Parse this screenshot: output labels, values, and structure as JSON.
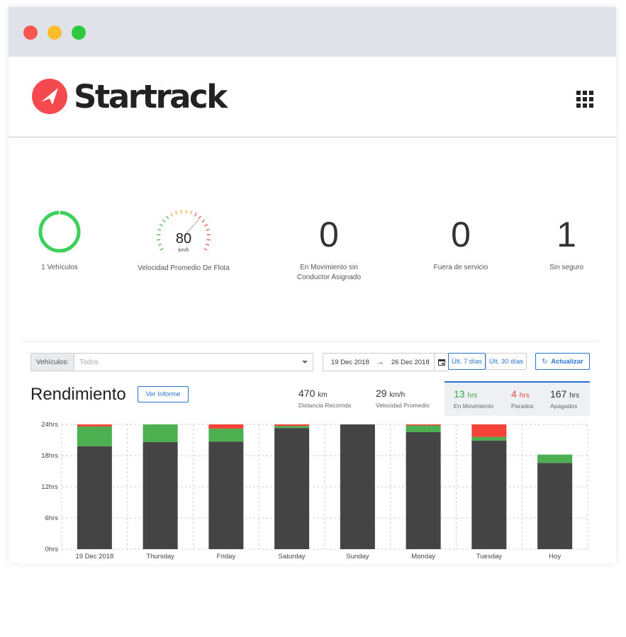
{
  "brand": {
    "name": "Startrack"
  },
  "kpis": {
    "vehicles": {
      "label": "1 Vehículos",
      "fraction": 1.0
    },
    "speed": {
      "value": "80",
      "unit": "km/h",
      "label": "Velocidad Promedio De Flota"
    },
    "moving_no_driver": {
      "value": "0",
      "label_line1": "En Movimiento sin",
      "label_line2": "Conductor Asignado"
    },
    "out_of_service": {
      "value": "0",
      "label": "Fuera de servicio"
    },
    "unsecured": {
      "value": "1",
      "label": "Sin seguro"
    }
  },
  "filters": {
    "vehicles_label": "Vehículos:",
    "vehicles_placeholder": "Todos",
    "date_from": "19 Dec 2018",
    "date_arrow": "→",
    "date_to": "26 Dec 2018",
    "last7": "Últ. 7 días",
    "last30": "Últ. 30 días",
    "refresh": "Actualizar"
  },
  "report": {
    "title": "Rendimiento",
    "view_report": "Ver Informe",
    "distance": {
      "value": "470",
      "unit": "km",
      "label": "Distancia Recorrida"
    },
    "avg_speed": {
      "value": "29",
      "unit": "km/h",
      "label": "Velocidad Promedio"
    },
    "moving": {
      "value": "13",
      "unit": "hrs",
      "label": "En Movimiento"
    },
    "stopped": {
      "value": "4",
      "unit": "hrs",
      "label": "Parados"
    },
    "off": {
      "value": "167",
      "unit": "hrs",
      "label": "Apagados"
    }
  },
  "colors": {
    "accent": "#2a72d4",
    "moving": "#4caf50",
    "stopped": "#f44336",
    "off": "#444444"
  },
  "chart_data": {
    "type": "bar",
    "stacked": true,
    "categories": [
      "19 Dec 2018",
      "Thursday",
      "Friday",
      "Saturday",
      "Sunday",
      "Monday",
      "Tuesday",
      "Hoy"
    ],
    "series": [
      {
        "name": "Apagados",
        "color": "#444444",
        "values": [
          19.8,
          20.6,
          20.7,
          23.3,
          24,
          22.5,
          20.9,
          16.6
        ]
      },
      {
        "name": "En Movimiento",
        "color": "#4caf50",
        "values": [
          3.8,
          3.4,
          2.5,
          0.4,
          0,
          1.3,
          0.7,
          1.6
        ]
      },
      {
        "name": "Parados",
        "color": "#f44336",
        "values": [
          0.4,
          0,
          0.8,
          0.3,
          0,
          0.2,
          2.4,
          0
        ]
      }
    ],
    "yticks": [
      "0hrs",
      "6hrs",
      "12hrs",
      "18hrs",
      "24hrs"
    ],
    "ylim": [
      0,
      24
    ],
    "grid": true
  }
}
